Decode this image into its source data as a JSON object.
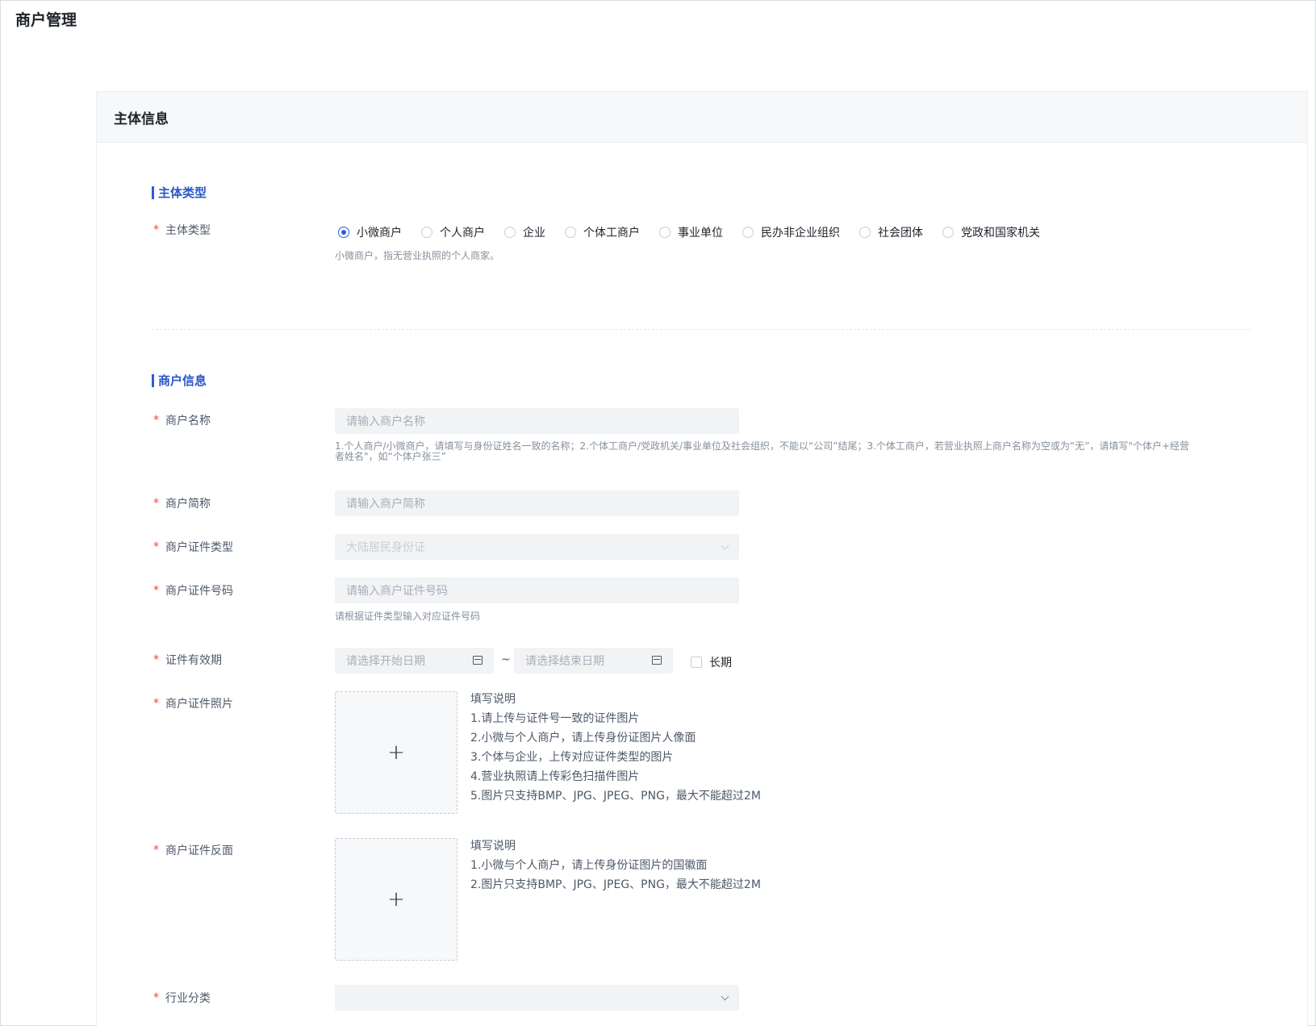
{
  "page": {
    "title": "商户管理"
  },
  "card": {
    "title": "主体信息"
  },
  "section_subject": {
    "title": "主体类型",
    "field_label": "主体类型",
    "options": [
      "小微商户",
      "个人商户",
      "企业",
      "个体工商户",
      "事业单位",
      "民办非企业组织",
      "社会团体",
      "党政和国家机关"
    ],
    "selected": "小微商户",
    "hint": "小微商户，指无营业执照的个人商家。"
  },
  "section_merchant": {
    "title": "商户信息",
    "name": {
      "label": "商户名称",
      "placeholder": "请输入商户名称",
      "hint_line1": "1.个人商户/小微商户，请填写与身份证姓名一致的名称；2.个体工商户/党政机关/事业单位及社会组织，不能以“公司”结尾；3.个体工商户，若营业执照上商户名称为空或为“无”，请填写\"个体户+经营",
      "hint_line2": "者姓名\"，如“个体户张三”"
    },
    "short_name": {
      "label": "商户简称",
      "placeholder": "请输入商户简称"
    },
    "cert_type": {
      "label": "商户证件类型",
      "value": "大陆居民身份证"
    },
    "cert_no": {
      "label": "商户证件号码",
      "placeholder": "请输入商户证件号码",
      "hint": "请根据证件类型输入对应证件号码"
    },
    "validity": {
      "label": "证件有效期",
      "start_placeholder": "请选择开始日期",
      "separator": "~",
      "end_placeholder": "请选择结束日期",
      "long_term_label": "长期"
    },
    "cert_photo": {
      "label": "商户证件照片",
      "notes": [
        "填写说明",
        "1.请上传与证件号一致的证件图片",
        "2.小微与个人商户，请上传身份证图片人像面",
        "3.个体与企业，上传对应证件类型的图片",
        "4.营业执照请上传彩色扫描件图片",
        "5.图片只支持BMP、JPG、JPEG、PNG，最大不能超过2M"
      ]
    },
    "cert_back": {
      "label": "商户证件反面",
      "notes": [
        "填写说明",
        "1.小微与个人商户，请上传身份证图片的国徽面",
        "2.图片只支持BMP、JPG、JPEG、PNG，最大不能超过2M"
      ]
    },
    "industry": {
      "label": "行业分类",
      "value": ""
    }
  },
  "icons": {
    "upload": "+",
    "required": "*"
  },
  "colors": {
    "accent": "#2d5cd6",
    "required": "#f53f3f"
  }
}
